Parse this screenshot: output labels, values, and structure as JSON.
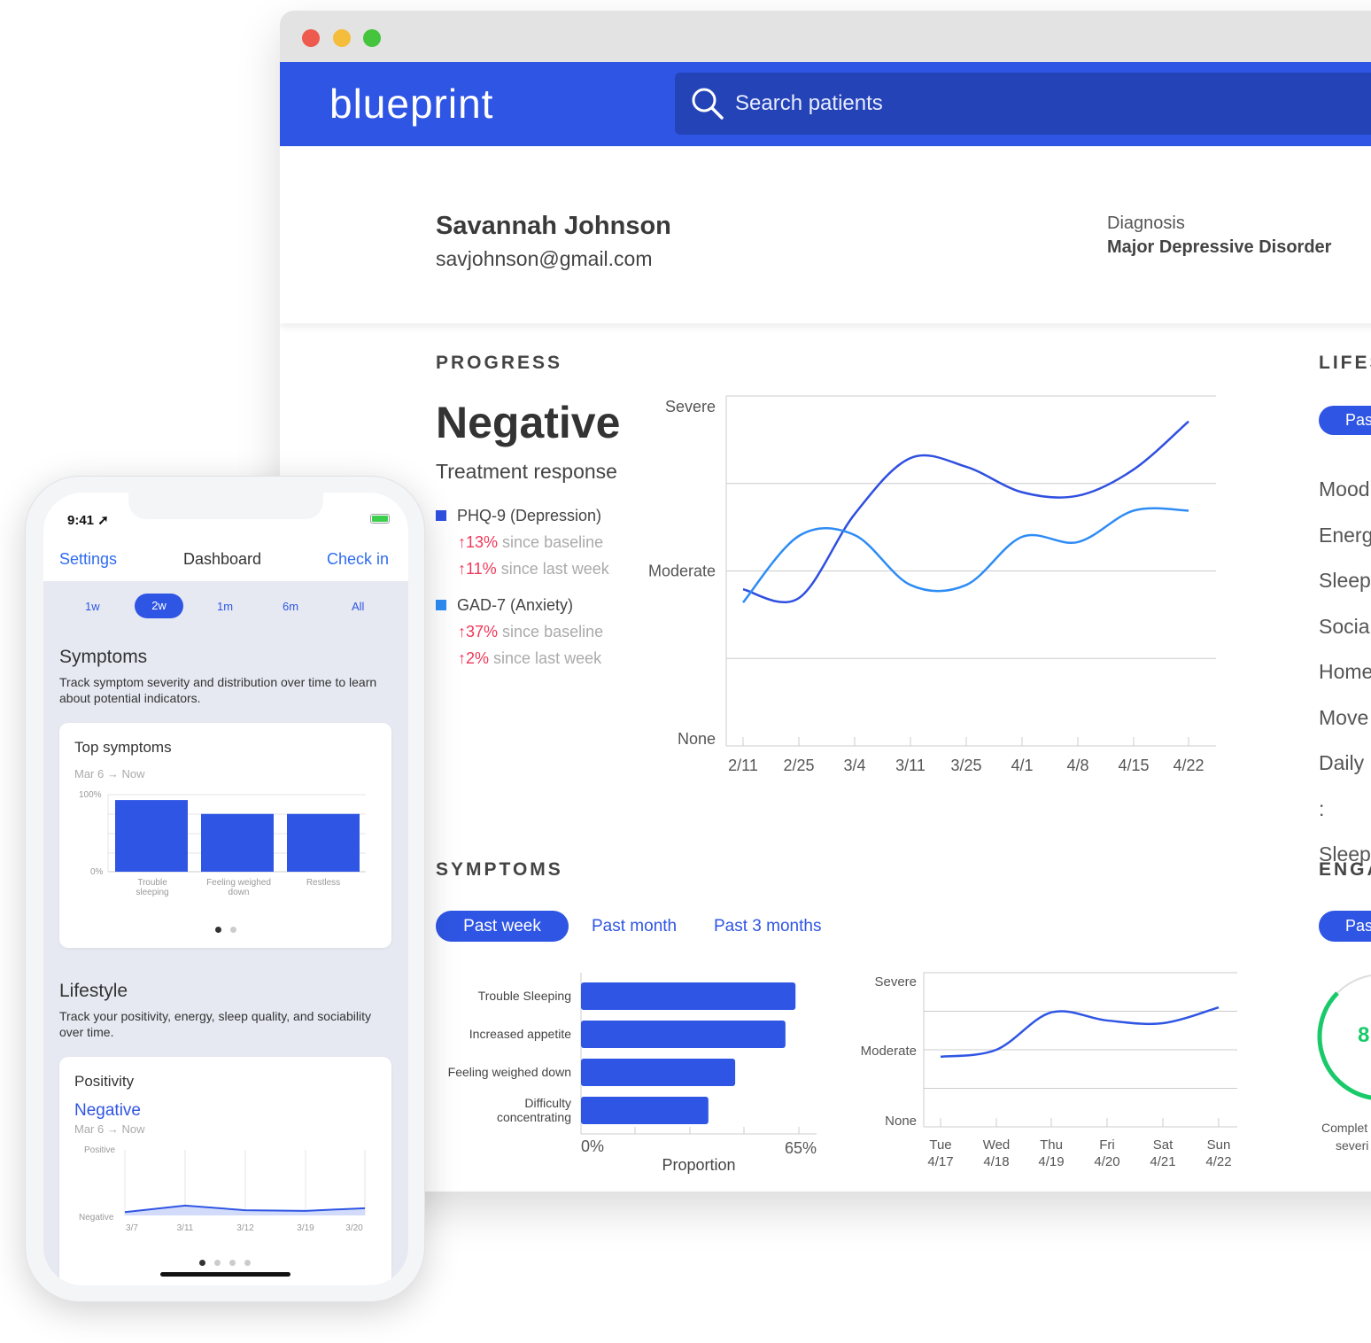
{
  "browser": {
    "logo": "blueprint",
    "search_placeholder": "Search patients"
  },
  "patient": {
    "name": "Savannah Johnson",
    "email": "savjohnson@gmail.com",
    "diagnosis_label": "Diagnosis",
    "diagnosis": "Major Depressive Disorder"
  },
  "progress": {
    "section": "PROGRESS",
    "status": "Negative",
    "subtitle": "Treatment response",
    "measures": [
      {
        "name": "PHQ-9 (Depression)",
        "color": "#2f4fe0",
        "baseline_change": "↑13%",
        "baseline_text": "since baseline",
        "week_change": "↑11%",
        "week_text": "since last week"
      },
      {
        "name": "GAD-7 (Anxiety)",
        "color": "#2e8cf5",
        "baseline_change": "↑37%",
        "baseline_text": "since baseline",
        "week_change": "↑2%",
        "week_text": "since last week"
      }
    ]
  },
  "symptoms": {
    "section": "SYMPTOMS",
    "tabs": [
      "Past week",
      "Past month",
      "Past 3 months"
    ],
    "active_tab": 0
  },
  "lifestyle_partial": {
    "section": "LIFES",
    "tab": "Pas",
    "items": [
      "Mood",
      "Energ",
      "Sleep",
      "Socia",
      "Home",
      "Move",
      "Daily :",
      "Sleep"
    ]
  },
  "engagement_partial": {
    "section": "ENGA",
    "tab": "Pas",
    "gauge_value": "8",
    "caption_1": "Complet",
    "caption_2": "severi",
    "gauge_color": "#19c96a"
  },
  "chart_data": [
    {
      "type": "line",
      "id": "progress",
      "categories": [
        "2/11",
        "2/25",
        "3/4",
        "3/11",
        "3/25",
        "4/1",
        "4/8",
        "4/15",
        "4/22"
      ],
      "y_levels": [
        "None",
        "",
        "Moderate",
        "",
        "Severe"
      ],
      "ylim": [
        0,
        4
      ],
      "grid": true,
      "series": [
        {
          "name": "PHQ-9 (Depression)",
          "color": "#2f4fe0",
          "values": [
            1.79,
            1.69,
            2.65,
            3.29,
            3.19,
            2.9,
            2.86,
            3.16,
            3.71
          ]
        },
        {
          "name": "GAD-7 (Anxiety)",
          "color": "#2e8cf5",
          "values": [
            1.64,
            2.4,
            2.41,
            1.84,
            1.84,
            2.39,
            2.33,
            2.69,
            2.69
          ]
        }
      ]
    },
    {
      "type": "bar",
      "id": "symptom-bars",
      "orientation": "horizontal",
      "categories": [
        "Trouble Sleeping",
        "Increased appetite",
        "Feeling weighed down",
        "Difficulty concentrating"
      ],
      "values": [
        64,
        61,
        46,
        38
      ],
      "xlabel": "Proportion",
      "tick_labels": [
        "0%",
        "65%"
      ],
      "xlim": [
        0,
        65
      ],
      "color": "#2f55e4"
    },
    {
      "type": "line",
      "id": "symptom-severity",
      "categories": [
        "Tue 4/17",
        "Wed 4/18",
        "Thu 4/19",
        "Fri 4/20",
        "Sat 4/21",
        "Sun 4/22"
      ],
      "y_levels": [
        "None",
        "",
        "Moderate",
        "",
        "Severe"
      ],
      "ylim": [
        0,
        4
      ],
      "grid": true,
      "series": [
        {
          "color": "#2f55e4",
          "values": [
            1.82,
            2.0,
            2.97,
            2.76,
            2.69,
            3.1
          ]
        }
      ]
    },
    {
      "type": "bar",
      "id": "phone-top-symptoms",
      "categories": [
        "Trouble sleeping",
        "Feeling weighed down",
        "Restless"
      ],
      "values": [
        93,
        75,
        75
      ],
      "ylim": [
        0,
        100
      ],
      "tick_labels": [
        "0%",
        "100%"
      ],
      "color": "#2f55e4"
    },
    {
      "type": "area",
      "id": "phone-positivity",
      "categories": [
        "3/7",
        "3/11",
        "3/12",
        "3/19",
        "3/20"
      ],
      "values": [
        0.05,
        0.15,
        0.08,
        0.07,
        0.11
      ],
      "ylim": [
        0,
        1
      ],
      "y_levels": [
        "Negative",
        "Positive"
      ],
      "color": "#2f55e4"
    }
  ],
  "phone": {
    "time": "9:41",
    "nav": {
      "left": "Settings",
      "title": "Dashboard",
      "right": "Check in"
    },
    "ranges": [
      "1w",
      "2w",
      "1m",
      "6m",
      "All"
    ],
    "active_range": 1,
    "symptoms": {
      "title": "Symptoms",
      "desc": "Track symptom severity and distribution over time to learn about potential indicators.",
      "card": {
        "title": "Top symptoms",
        "range": "Mar 6 → Now",
        "ticks": [
          "100%",
          "0%"
        ],
        "labels": [
          "Trouble sleeping",
          "Feeling weighed down",
          "Restless"
        ]
      }
    },
    "lifestyle": {
      "title": "Lifestyle",
      "desc": "Track your positivity, energy, sleep quality, and sociability over time.",
      "card": {
        "title": "Positivity",
        "value": "Negative",
        "range": "Mar 6 → Now",
        "ticks": [
          "Positive",
          "Negative"
        ]
      }
    }
  }
}
